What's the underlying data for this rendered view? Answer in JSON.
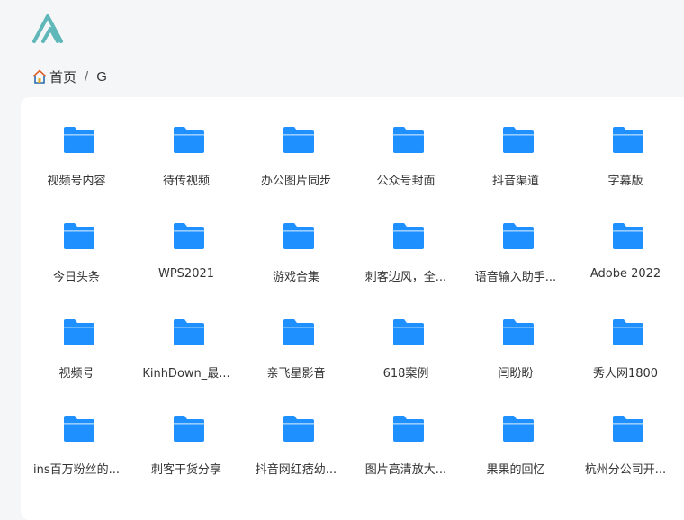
{
  "breadcrumb": {
    "home_label": "首页",
    "separator": "/",
    "current": "G"
  },
  "colors": {
    "folder": "#1e90ff",
    "logo_teal": "#5fb7b9"
  },
  "folders": [
    {
      "label": "视频号内容"
    },
    {
      "label": "待传视频"
    },
    {
      "label": "办公图片同步"
    },
    {
      "label": "公众号封面"
    },
    {
      "label": "抖音渠道"
    },
    {
      "label": "字幕版"
    },
    {
      "label": "今日头条"
    },
    {
      "label": "WPS2021"
    },
    {
      "label": "游戏合集"
    },
    {
      "label": "刺客边风，全..."
    },
    {
      "label": "语音输入助手..."
    },
    {
      "label": "Adobe 2022"
    },
    {
      "label": "视频号"
    },
    {
      "label": "KinhDown_最..."
    },
    {
      "label": "亲飞星影音"
    },
    {
      "label": "618案例"
    },
    {
      "label": "闫盼盼"
    },
    {
      "label": "秀人网1800"
    },
    {
      "label": "ins百万粉丝的..."
    },
    {
      "label": "刺客干货分享"
    },
    {
      "label": "抖音网红痞幼..."
    },
    {
      "label": "图片高清放大..."
    },
    {
      "label": "果果的回忆"
    },
    {
      "label": "杭州分公司开..."
    }
  ]
}
